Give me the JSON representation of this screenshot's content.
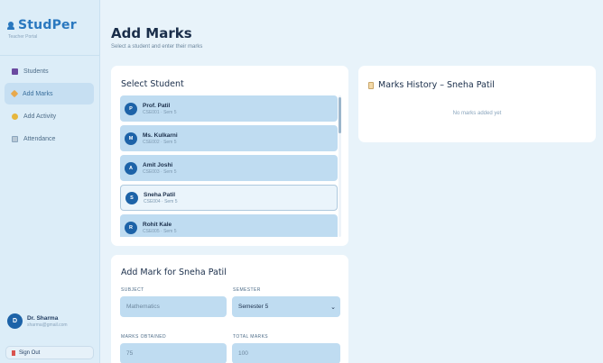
{
  "brand": {
    "name": "StudPer",
    "subtitle": "Teacher Portal"
  },
  "nav": [
    {
      "label": "Students",
      "icon": "students-icon",
      "active": false
    },
    {
      "label": "Add Marks",
      "icon": "marks-icon",
      "active": true
    },
    {
      "label": "Add Activity",
      "icon": "activity-icon",
      "active": false
    },
    {
      "label": "Attendance",
      "icon": "attendance-icon",
      "active": false
    }
  ],
  "user": {
    "initial": "D",
    "name": "Dr. Sharma",
    "email": "sharma@gmail.com"
  },
  "signout_label": "Sign Out",
  "header": {
    "title": "Add Marks",
    "subtitle": "Select a student and enter their marks"
  },
  "select_card": {
    "title": "Select Student",
    "students": [
      {
        "initial": "P",
        "name": "Prof. Patil",
        "sub": "CSE001 · Sem 5"
      },
      {
        "initial": "M",
        "name": "Ms. Kulkarni",
        "sub": "CSE002 · Sem 5"
      },
      {
        "initial": "A",
        "name": "Amit Joshi",
        "sub": "CSE003 · Sem 5"
      },
      {
        "initial": "S",
        "name": "Sneha Patil",
        "sub": "CSE004 · Sem 5"
      },
      {
        "initial": "R",
        "name": "Rohit Kale",
        "sub": "CSE005 · Sem 5"
      }
    ]
  },
  "history_card": {
    "title": "Marks History – Sneha Patil",
    "empty_text": "No marks added yet"
  },
  "add_card": {
    "title": "Add Mark for Sneha Patil",
    "subject_label": "SUBJECT",
    "subject_placeholder": "Mathematics",
    "semester_label": "SEMESTER",
    "semester_value": "Semester 5",
    "marks_label": "MARKS OBTAINED",
    "marks_placeholder": "75",
    "total_label": "TOTAL MARKS",
    "total_placeholder": "100"
  },
  "colors": {
    "accent": "#2a78bf",
    "avatar": "#1d63a8",
    "item_bg": "#bfdcf1"
  }
}
